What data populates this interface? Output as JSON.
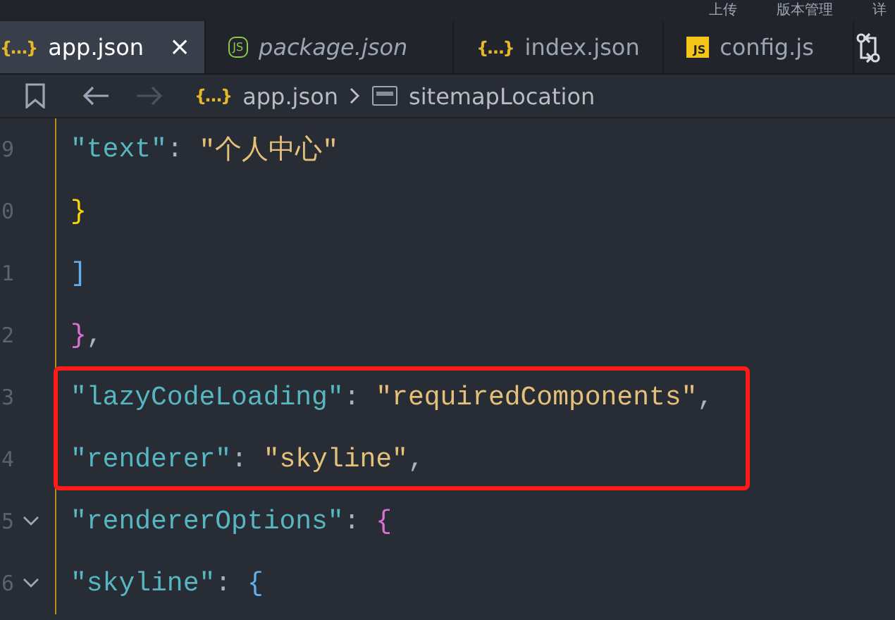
{
  "top_menu": [
    "上传",
    "版本管理",
    "详"
  ],
  "tabs": [
    {
      "label": "app.json",
      "kind": "json",
      "icon_text": "{…}",
      "selected": true,
      "preview": false,
      "closable": true,
      "close_text": "×"
    },
    {
      "label": "package.json",
      "kind": "node",
      "icon_text": "JS",
      "selected": false,
      "preview": true,
      "closable": false
    },
    {
      "label": "index.json",
      "kind": "json",
      "icon_text": "{…}",
      "selected": false,
      "preview": false,
      "closable": false
    },
    {
      "label": "config.js",
      "kind": "js",
      "icon_text": "JS",
      "selected": false,
      "preview": false,
      "closable": false
    }
  ],
  "breadcrumb": {
    "back_disabled": false,
    "forward_disabled": true,
    "items": [
      {
        "label": "app.json",
        "kind": "json",
        "icon_text": "{…}"
      },
      {
        "label": "sitemapLocation",
        "kind": "symbol"
      }
    ]
  },
  "lines": [
    {
      "children": [
        {
          "children": [
            {
              "children": [
                {
                  "number": "9",
                  "fold": false,
                  "highlight": false,
                  "tokens": [
                    {
                      "kind": "key",
                      "text": "\"text\""
                    },
                    {
                      "kind": "punct",
                      "text": ": "
                    },
                    {
                      "kind": "string",
                      "text": "\"个人中心\""
                    }
                  ]
                }
              ]
            },
            {
              "number": "0",
              "fold": false,
              "highlight": false,
              "tokens": [
                {
                  "kind": "bracket",
                  "text": "}",
                  "color": "#ffd700"
                }
              ]
            }
          ]
        },
        {
          "number": "1",
          "fold": false,
          "highlight": false,
          "tokens": [
            {
              "kind": "bracket",
              "text": "]",
              "color": "#61afef"
            }
          ]
        }
      ]
    },
    {
      "number": "2",
      "fold": false,
      "highlight": false,
      "tokens": [
        {
          "kind": "bracket",
          "text": "}",
          "color": "#da70d6"
        },
        {
          "kind": "punct",
          "text": ","
        }
      ]
    },
    {
      "number": "3",
      "fold": false,
      "highlight": true,
      "tokens": [
        {
          "kind": "key",
          "text": "\"lazyCodeLoading\""
        },
        {
          "kind": "punct",
          "text": ": "
        },
        {
          "kind": "string",
          "text": "\"requiredComponents\""
        },
        {
          "kind": "punct",
          "text": ","
        }
      ]
    },
    {
      "number": "4",
      "fold": false,
      "highlight": true,
      "tokens": [
        {
          "kind": "key",
          "text": "\"renderer\""
        },
        {
          "kind": "punct",
          "text": ": "
        },
        {
          "kind": "string",
          "text": "\"skyline\""
        },
        {
          "kind": "punct",
          "text": ","
        }
      ]
    },
    {
      "number": "5",
      "fold": true,
      "highlight": false,
      "tokens": [
        {
          "kind": "key",
          "text": "\"rendererOptions\""
        },
        {
          "kind": "punct",
          "text": ": "
        },
        {
          "kind": "bracket",
          "text": "{",
          "color": "#da70d6"
        }
      ],
      "children": [
        {
          "number": "6",
          "fold": true,
          "highlight": false,
          "tokens": [
            {
              "kind": "key",
              "text": "\"skyline\""
            },
            {
              "kind": "punct",
              "text": ": "
            },
            {
              "kind": "bracket",
              "text": "{",
              "color": "#61afef"
            }
          ]
        }
      ]
    }
  ]
}
